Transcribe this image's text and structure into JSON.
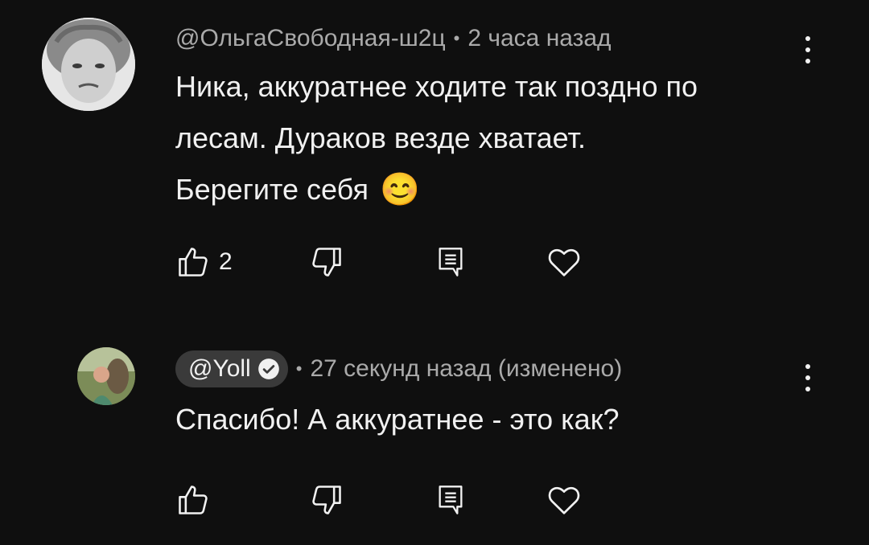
{
  "comments": [
    {
      "author": "@ОльгаСвободная-ш2ц",
      "separator": "•",
      "time": "2 часа назад",
      "lines": [
        "Ника, аккуратнее ходите так поздно по",
        "лесам. Дураков везде хватает.",
        "Берегите себя"
      ],
      "emoji": "😊",
      "likes": "2"
    },
    {
      "author": "@Yoll",
      "separator": "•",
      "time": "27 секунд назад (изменено)",
      "lines": [
        "Спасибо! А аккуратнее - это как?"
      ],
      "likes": ""
    }
  ],
  "icons": {
    "like": "thumbs-up-icon",
    "dislike": "thumbs-down-icon",
    "reply": "reply-icon",
    "heart": "heart-icon",
    "menu": "more-vert-icon",
    "verified": "verified-check-icon"
  }
}
